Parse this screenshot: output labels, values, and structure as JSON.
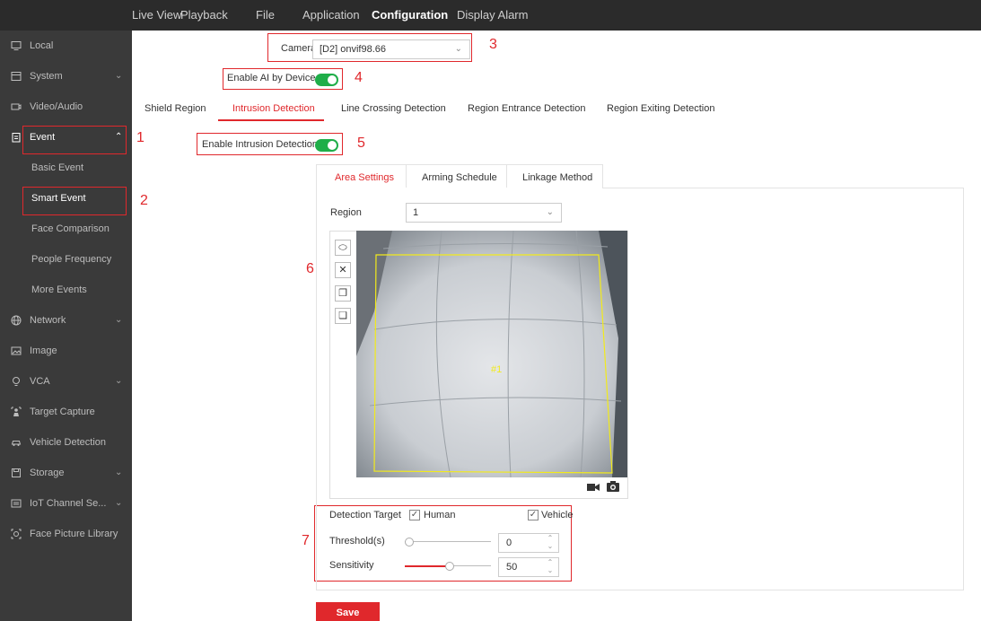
{
  "topnav": [
    {
      "label": "Live View"
    },
    {
      "label": "Playback"
    },
    {
      "label": "File"
    },
    {
      "label": "Application"
    },
    {
      "label": "Configuration",
      "active": true
    },
    {
      "label": "Display Alarm"
    }
  ],
  "sidebar": {
    "items": [
      {
        "label": "Local",
        "icon": "monitor-icon"
      },
      {
        "label": "System",
        "icon": "system-icon",
        "chevron": "down"
      },
      {
        "label": "Video/Audio",
        "icon": "video-icon"
      },
      {
        "label": "Event",
        "icon": "clipboard-icon",
        "chevron": "up"
      },
      {
        "label": "Basic Event"
      },
      {
        "label": "Smart Event"
      },
      {
        "label": "Face Comparison"
      },
      {
        "label": "People Frequency"
      },
      {
        "label": "More Events"
      },
      {
        "label": "Network",
        "icon": "globe-icon",
        "chevron": "down"
      },
      {
        "label": "Image",
        "icon": "image-icon"
      },
      {
        "label": "VCA",
        "icon": "bulb-icon",
        "chevron": "down"
      },
      {
        "label": "Target Capture",
        "icon": "target-icon"
      },
      {
        "label": "Vehicle Detection",
        "icon": "car-icon"
      },
      {
        "label": "Storage",
        "icon": "storage-icon",
        "chevron": "down"
      },
      {
        "label": "IoT Channel Se...",
        "icon": "iot-icon",
        "chevron": "down"
      },
      {
        "label": "Face Picture Library",
        "icon": "face-icon"
      }
    ]
  },
  "annotations": [
    "1",
    "2",
    "3",
    "4",
    "5",
    "6",
    "7"
  ],
  "camera": {
    "label": "Camera",
    "value": "[D2] onvif98.66"
  },
  "ai_toggle": {
    "label": "Enable AI by Device",
    "on": true
  },
  "tabs": [
    {
      "label": "Shield Region"
    },
    {
      "label": "Intrusion Detection",
      "active": true
    },
    {
      "label": "Line Crossing Detection"
    },
    {
      "label": "Region Entrance Detection"
    },
    {
      "label": "Region Exiting Detection"
    }
  ],
  "intrusion_toggle": {
    "label": "Enable Intrusion Detection",
    "on": true
  },
  "subtabs": [
    {
      "label": "Area Settings",
      "active": true
    },
    {
      "label": "Arming Schedule"
    },
    {
      "label": "Linkage Method"
    }
  ],
  "region": {
    "label": "Region",
    "value": "1"
  },
  "video": {
    "region_label": "#1",
    "tools": [
      "polygon-draw-icon",
      "clear-icon",
      "select-area-icon",
      "minimum-size-icon"
    ]
  },
  "detection": {
    "target_label": "Detection Target",
    "human_label": "Human",
    "human_checked": true,
    "vehicle_label": "Vehicle",
    "vehicle_checked": true,
    "threshold_label": "Threshold(s)",
    "threshold_value": "0",
    "threshold_level": 0,
    "sensitivity_label": "Sensitivity",
    "sensitivity_value": "50",
    "sensitivity_level": 0.5
  },
  "save_label": "Save",
  "colors": {
    "accent": "#e0282c",
    "toggle_on": "#1fae49",
    "sidebar_bg": "#3a3a3a",
    "topbar_bg": "#2b2b2b",
    "region_outline": "#f2ea1b"
  }
}
